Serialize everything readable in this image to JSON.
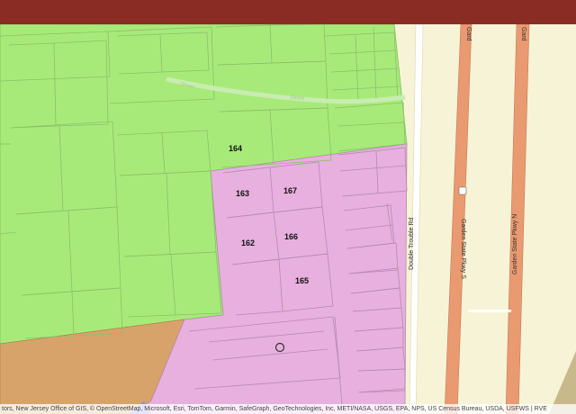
{
  "colors": {
    "header": "#8b2c24",
    "background": "#f7f3d6",
    "zone_green": "#a8ea7a",
    "zone_pink": "#e7b0de",
    "zone_orange": "#d8a36a",
    "zone_blue": "#8a8fe6",
    "parcel_line": "#8cbf6a",
    "highway": "#e99a70",
    "local_road": "#ffffff"
  },
  "parcel_labels": [
    "164",
    "163",
    "167",
    "162",
    "166",
    "165"
  ],
  "roads": {
    "garden_state_pkwy_s": "Garden State Pkwy S",
    "garden_state_pkwy_n": "Garden State Pkwy N",
    "double_trouble_rd": "Double Trouble Rd",
    "gard_1": "Gard",
    "gard_2": "Gard",
    "street_faint_1": "Street",
    "street_faint_2": "Street"
  },
  "highway_shield": "",
  "location_marker_icon": "circle-marker-icon",
  "attribution": "tors, New Jersey Office of GIS, © OpenStreetMap, Microsoft, Esri, TomTom, Garmin, SafeGraph, GeoTechnologies, Inc, METI/NASA, USGS, EPA, NPS, US Census Bureau, USDA, USFWS | RVE"
}
